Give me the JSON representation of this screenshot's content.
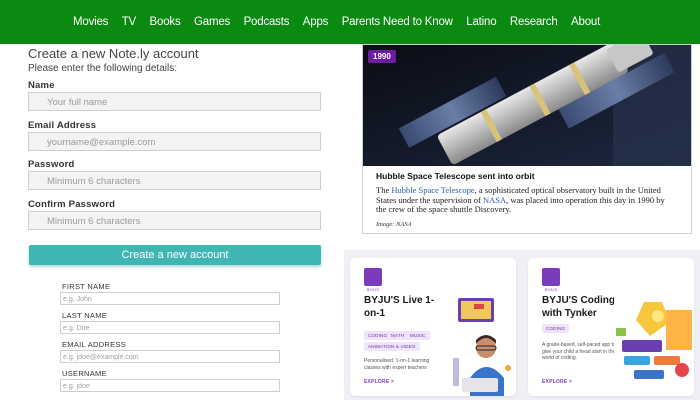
{
  "nav": {
    "items": [
      "Movies",
      "TV",
      "Books",
      "Games",
      "Podcasts",
      "Apps",
      "Parents Need to Know",
      "Latino",
      "Research",
      "About"
    ]
  },
  "signup": {
    "heading": "Create a new Note.ly account",
    "subheading": "Please enter the following details:",
    "name_label": "Name",
    "name_placeholder": "Your full name",
    "email_label": "Email Address",
    "email_placeholder": "yourname@example.com",
    "password_label": "Password",
    "password_placeholder": "Minimum 6 characters",
    "confirm_label": "Confirm Password",
    "confirm_placeholder": "Minimum 6 characters",
    "submit_label": "Create a new account"
  },
  "form2": {
    "first_name_label": "FIRST NAME",
    "first_name_placeholder": "e.g. John",
    "last_name_label": "LAST NAME",
    "last_name_placeholder": "e.g. Doe",
    "email_label": "EMAIL ADDRESS",
    "email_placeholder": "e.g. jdoe@example.com",
    "username_label": "USERNAME",
    "username_placeholder": "e.g. jdoe"
  },
  "news": {
    "year": "1990",
    "title": "Hubble Space Telescope sent into orbit",
    "body_pre": "The ",
    "link1": "Hubble Space Telescope",
    "body_mid": ", a sophisticated optical observatory built in the United States under the supervision of ",
    "link2": "NASA",
    "body_post": ", was placed into operation this day in 1990 by the crew of the space shuttle Discovery.",
    "credit": "Image: NASA"
  },
  "byju": {
    "card1": {
      "logo_text": "BYJU'S",
      "title": "BYJU'S Live 1-on-1",
      "tags": [
        "CODING",
        "MATH",
        "MUSIC",
        "ANIMATION & VIDEO"
      ],
      "desc": "Personalised, 1-on-1 learning classes with expert teachers",
      "explore": "EXPLORE >"
    },
    "card2": {
      "logo_text": "BYJU'S",
      "title": "BYJU'S Coding with Tynker",
      "tags": [
        "CODING"
      ],
      "desc": "A grade-based, self-paced app to give your child a head start in the world of coding.",
      "explore": "EXPLORE >"
    }
  },
  "colors": {
    "nav_bg": "#0b8a12",
    "button": "#3fb5b4",
    "badge": "#6b1fa0",
    "brand_purple": "#7b3bbd"
  }
}
